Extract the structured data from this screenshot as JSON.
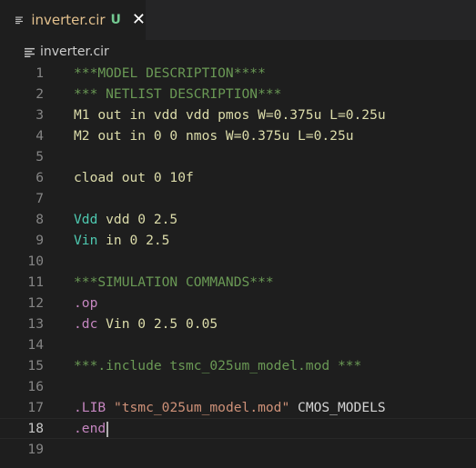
{
  "tab": {
    "filename": "inverter.cir",
    "status_badge": "U",
    "close_glyph": "✕",
    "icon": "file-lines-icon"
  },
  "breadcrumb": {
    "filename": "inverter.cir",
    "icon": "file-lines-icon"
  },
  "editor": {
    "current_line": 18,
    "lines": [
      {
        "num": "1",
        "tokens": [
          {
            "t": "***MODEL DESCRIPTION****",
            "k": "comment"
          }
        ]
      },
      {
        "num": "2",
        "tokens": [
          {
            "t": "*** NETLIST DESCRIPTION***",
            "k": "comment"
          }
        ]
      },
      {
        "num": "3",
        "tokens": [
          {
            "t": "M1 out in vdd vdd pmos W=0.375u L=0.25u",
            "k": "yellow"
          }
        ]
      },
      {
        "num": "4",
        "tokens": [
          {
            "t": "M2 out in 0 0 nmos W=0.375u L=0.25u",
            "k": "yellow"
          }
        ]
      },
      {
        "num": "5",
        "tokens": []
      },
      {
        "num": "6",
        "tokens": [
          {
            "t": "cload out 0 10f",
            "k": "yellow"
          }
        ]
      },
      {
        "num": "7",
        "tokens": []
      },
      {
        "num": "8",
        "tokens": [
          {
            "t": "Vdd",
            "k": "green"
          },
          {
            "t": " vdd 0 2.5",
            "k": "yellow"
          }
        ]
      },
      {
        "num": "9",
        "tokens": [
          {
            "t": "Vin",
            "k": "green"
          },
          {
            "t": " in 0 2.5",
            "k": "yellow"
          }
        ]
      },
      {
        "num": "10",
        "tokens": []
      },
      {
        "num": "11",
        "tokens": [
          {
            "t": "***SIMULATION COMMANDS***",
            "k": "comment"
          }
        ]
      },
      {
        "num": "12",
        "tokens": [
          {
            "t": ".op",
            "k": "purple"
          }
        ]
      },
      {
        "num": "13",
        "tokens": [
          {
            "t": ".dc",
            "k": "purple"
          },
          {
            "t": " Vin 0 2.5 0.05",
            "k": "yellow"
          }
        ]
      },
      {
        "num": "14",
        "tokens": []
      },
      {
        "num": "15",
        "tokens": [
          {
            "t": "***.include tsmc_025um_model.mod ***",
            "k": "comment"
          }
        ]
      },
      {
        "num": "16",
        "tokens": []
      },
      {
        "num": "17",
        "tokens": [
          {
            "t": ".LIB",
            "k": "purple"
          },
          {
            "t": " ",
            "k": "plain"
          },
          {
            "t": "\"tsmc_025um_model.mod\"",
            "k": "string"
          },
          {
            "t": " CMOS_MODELS",
            "k": "plain"
          }
        ]
      },
      {
        "num": "18",
        "tokens": [
          {
            "t": ".end",
            "k": "purple"
          }
        ]
      },
      {
        "num": "19",
        "tokens": []
      }
    ]
  },
  "colors": {
    "background": "#1e1e1e",
    "tab_bar": "#252526",
    "tab_label_modified": "#e2c08d",
    "badge_untracked": "#73c991",
    "comment": "#6a9955",
    "keyword": "#c586c0",
    "identifier": "#dcdcaa",
    "type": "#4ec9b0",
    "string": "#ce9178",
    "line_number": "#858585"
  }
}
